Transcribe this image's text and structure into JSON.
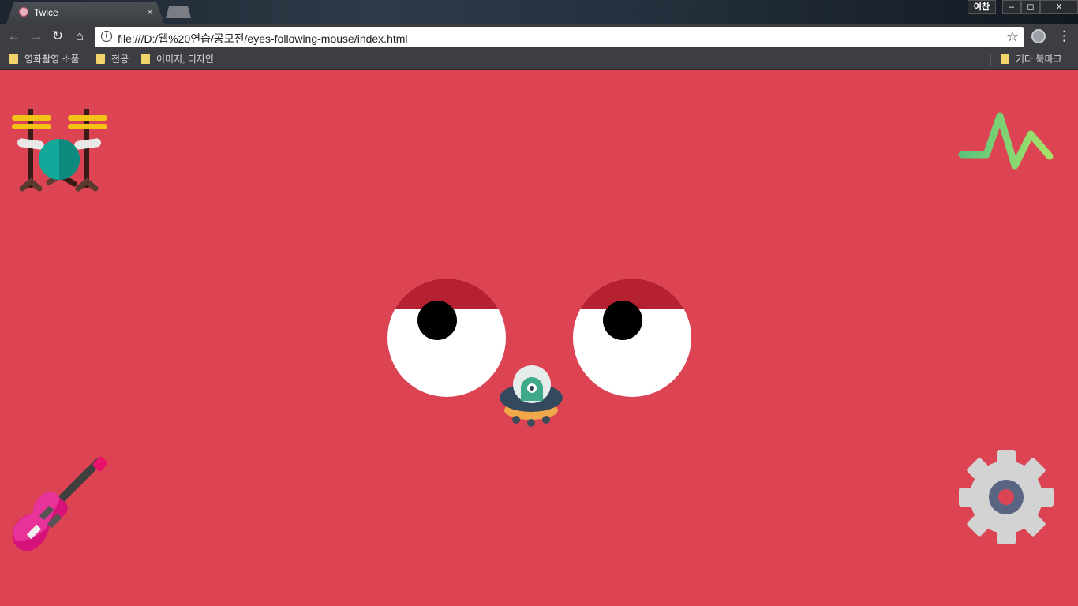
{
  "browser": {
    "tab_title": "Twice",
    "tab_close": "×",
    "window": {
      "ime": "여찬",
      "minimize": "–",
      "restore": "◻",
      "close": "X"
    },
    "nav": {
      "back": "←",
      "forward": "→",
      "reload": "↻",
      "home": "⌂"
    },
    "info": "i",
    "url": "file:///D:/웹%20연습/공모전/eyes-following-mouse/index.html",
    "star": "☆",
    "menu": "⋮",
    "bookmarks": [
      {
        "label": "영화촬영 소품"
      },
      {
        "label": "전공"
      },
      {
        "label": "이미지, 디자인"
      }
    ],
    "other_bookmarks": "기타 북마크"
  },
  "page": {
    "background": "#dc4453",
    "eyelid_color": "#b52131",
    "icons": [
      "drums-icon",
      "pulse-line-icon",
      "ufo-icon",
      "guitar-icon",
      "gear-icon"
    ]
  }
}
